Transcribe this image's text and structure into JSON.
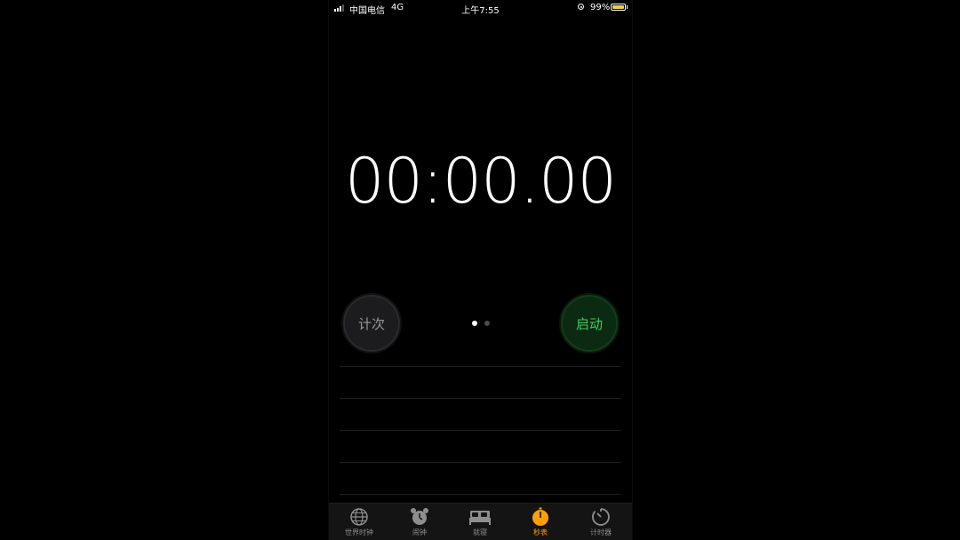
{
  "status_bar": {
    "carrier": "中国电信",
    "network": "4G",
    "time": "上午7:55",
    "battery_percent": "99%",
    "battery_level": 0.99,
    "battery_color": "#f4d03f"
  },
  "stopwatch": {
    "display": "00:00.00"
  },
  "buttons": {
    "lap_label": "计次",
    "start_label": "启动",
    "start_color": "#3fcf5f"
  },
  "pager": {
    "pages": 2,
    "current": 1
  },
  "tab_bar": {
    "accent_color": "#ff9f0a",
    "tabs": [
      {
        "label": "世界时钟",
        "icon": "globe-icon"
      },
      {
        "label": "闹钟",
        "icon": "alarm-clock-icon"
      },
      {
        "label": "就寝",
        "icon": "bed-icon"
      },
      {
        "label": "秒表",
        "icon": "stopwatch-icon",
        "active": true
      },
      {
        "label": "计时器",
        "icon": "timer-icon"
      }
    ]
  }
}
